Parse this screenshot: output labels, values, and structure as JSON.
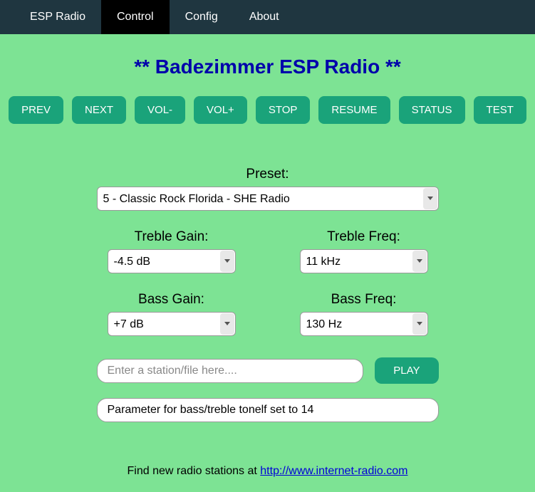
{
  "nav": {
    "items": [
      {
        "label": "ESP Radio"
      },
      {
        "label": "Control"
      },
      {
        "label": "Config"
      },
      {
        "label": "About"
      }
    ]
  },
  "title": "** Badezimmer ESP Radio **",
  "buttons": {
    "prev": "PREV",
    "next": "NEXT",
    "voldown": "VOL-",
    "volup": "VOL+",
    "stop": "STOP",
    "resume": "RESUME",
    "status": "STATUS",
    "test": "TEST",
    "play": "PLAY"
  },
  "preset": {
    "label": "Preset:",
    "value": "5 - Classic Rock Florida - SHE Radio"
  },
  "treble_gain": {
    "label": "Treble Gain:",
    "value": "-4.5 dB"
  },
  "treble_freq": {
    "label": "Treble Freq:",
    "value": "11 kHz"
  },
  "bass_gain": {
    "label": "Bass Gain:",
    "value": "+7 dB"
  },
  "bass_freq": {
    "label": "Bass Freq:",
    "value": "130 Hz"
  },
  "station_input": {
    "placeholder": "Enter a station/file here....",
    "value": ""
  },
  "status_text": "Parameter for bass/treble tonelf set to 14",
  "footer": {
    "prefix": "Find new radio stations at ",
    "link_text": "http://www.internet-radio.com",
    "link_href": "http://www.internet-radio.com"
  }
}
